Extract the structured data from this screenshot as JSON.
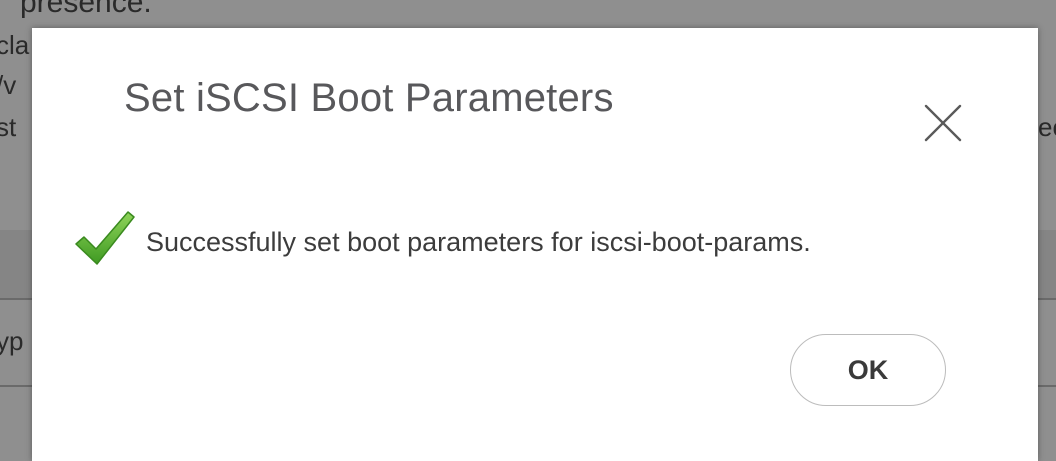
{
  "background": {
    "fragments": [
      {
        "text": "presence."
      },
      {
        "text": "cla"
      },
      {
        "text": "/v"
      },
      {
        "text": "st"
      },
      {
        "text": "yp"
      },
      {
        "text": "ec"
      }
    ]
  },
  "dialog": {
    "title": "Set iSCSI Boot Parameters",
    "close_icon": "close-icon",
    "message": "Successfully set boot parameters for iscsi-boot-params.",
    "status_icon": "checkmark-icon",
    "ok_label": "OK"
  },
  "colors": {
    "overlay": "#8f8f8f",
    "title": "#58585b",
    "check_green": "#5cb531",
    "button_border": "#bcbcbc"
  }
}
